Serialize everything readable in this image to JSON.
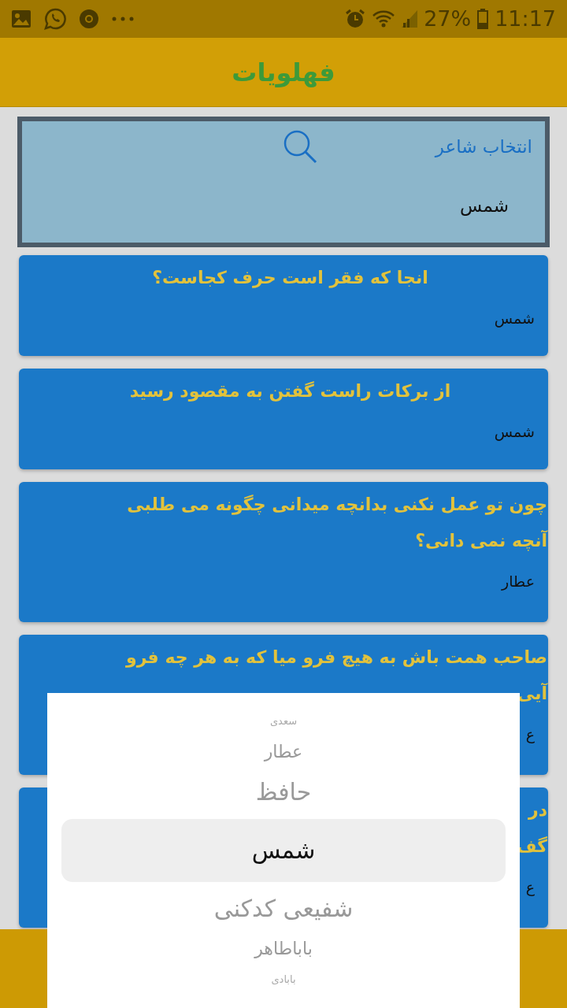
{
  "status_bar": {
    "battery": "27%",
    "time": "11:17"
  },
  "app_bar": {
    "title": "فهلویات"
  },
  "search_panel": {
    "label": "انتخاب شاعر",
    "value": "شمس"
  },
  "quotes": [
    {
      "lines": [
        "انجا که فقر است حرف کجاست؟"
      ],
      "poet": "شمس"
    },
    {
      "lines": [
        "از برکات راست گفتن به مقصود رسید"
      ],
      "poet": "شمس"
    },
    {
      "lines": [
        "چون تو عمل نکنی بدانچه میدانی  چگونه می طلبی",
        "آنچه نمی دانی؟"
      ],
      "poet": "عطار"
    },
    {
      "lines": [
        "صاحب همت باش به هیچ فرو میا که به هر چه فرو",
        "آیی"
      ],
      "poet": "ع"
    },
    {
      "lines": [
        "در",
        "گف"
      ],
      "poet": "ع"
    }
  ],
  "picker": {
    "items": [
      {
        "label": "سعدی",
        "selected": false
      },
      {
        "label": "عطار",
        "selected": false
      },
      {
        "label": "حافظ",
        "selected": false
      },
      {
        "label": "شمس",
        "selected": true
      },
      {
        "label": "شفیعی کدکنی",
        "selected": false
      },
      {
        "label": "باباطاهر",
        "selected": false
      },
      {
        "label": "بابادی",
        "selected": false
      }
    ]
  }
}
